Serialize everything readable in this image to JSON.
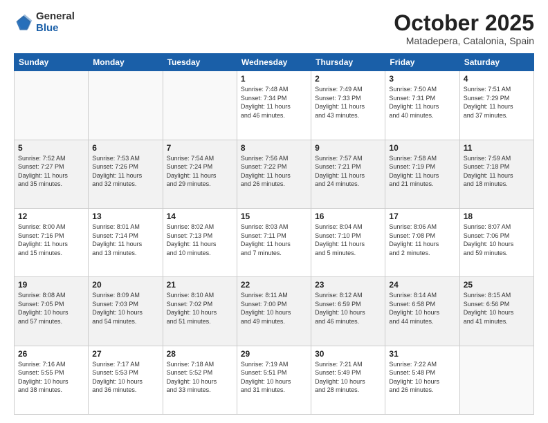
{
  "header": {
    "logo_general": "General",
    "logo_blue": "Blue",
    "month_title": "October 2025",
    "subtitle": "Matadepera, Catalonia, Spain"
  },
  "days_of_week": [
    "Sunday",
    "Monday",
    "Tuesday",
    "Wednesday",
    "Thursday",
    "Friday",
    "Saturday"
  ],
  "weeks": [
    [
      {
        "num": "",
        "info": ""
      },
      {
        "num": "",
        "info": ""
      },
      {
        "num": "",
        "info": ""
      },
      {
        "num": "1",
        "info": "Sunrise: 7:48 AM\nSunset: 7:34 PM\nDaylight: 11 hours\nand 46 minutes."
      },
      {
        "num": "2",
        "info": "Sunrise: 7:49 AM\nSunset: 7:33 PM\nDaylight: 11 hours\nand 43 minutes."
      },
      {
        "num": "3",
        "info": "Sunrise: 7:50 AM\nSunset: 7:31 PM\nDaylight: 11 hours\nand 40 minutes."
      },
      {
        "num": "4",
        "info": "Sunrise: 7:51 AM\nSunset: 7:29 PM\nDaylight: 11 hours\nand 37 minutes."
      }
    ],
    [
      {
        "num": "5",
        "info": "Sunrise: 7:52 AM\nSunset: 7:27 PM\nDaylight: 11 hours\nand 35 minutes."
      },
      {
        "num": "6",
        "info": "Sunrise: 7:53 AM\nSunset: 7:26 PM\nDaylight: 11 hours\nand 32 minutes."
      },
      {
        "num": "7",
        "info": "Sunrise: 7:54 AM\nSunset: 7:24 PM\nDaylight: 11 hours\nand 29 minutes."
      },
      {
        "num": "8",
        "info": "Sunrise: 7:56 AM\nSunset: 7:22 PM\nDaylight: 11 hours\nand 26 minutes."
      },
      {
        "num": "9",
        "info": "Sunrise: 7:57 AM\nSunset: 7:21 PM\nDaylight: 11 hours\nand 24 minutes."
      },
      {
        "num": "10",
        "info": "Sunrise: 7:58 AM\nSunset: 7:19 PM\nDaylight: 11 hours\nand 21 minutes."
      },
      {
        "num": "11",
        "info": "Sunrise: 7:59 AM\nSunset: 7:18 PM\nDaylight: 11 hours\nand 18 minutes."
      }
    ],
    [
      {
        "num": "12",
        "info": "Sunrise: 8:00 AM\nSunset: 7:16 PM\nDaylight: 11 hours\nand 15 minutes."
      },
      {
        "num": "13",
        "info": "Sunrise: 8:01 AM\nSunset: 7:14 PM\nDaylight: 11 hours\nand 13 minutes."
      },
      {
        "num": "14",
        "info": "Sunrise: 8:02 AM\nSunset: 7:13 PM\nDaylight: 11 hours\nand 10 minutes."
      },
      {
        "num": "15",
        "info": "Sunrise: 8:03 AM\nSunset: 7:11 PM\nDaylight: 11 hours\nand 7 minutes."
      },
      {
        "num": "16",
        "info": "Sunrise: 8:04 AM\nSunset: 7:10 PM\nDaylight: 11 hours\nand 5 minutes."
      },
      {
        "num": "17",
        "info": "Sunrise: 8:06 AM\nSunset: 7:08 PM\nDaylight: 11 hours\nand 2 minutes."
      },
      {
        "num": "18",
        "info": "Sunrise: 8:07 AM\nSunset: 7:06 PM\nDaylight: 10 hours\nand 59 minutes."
      }
    ],
    [
      {
        "num": "19",
        "info": "Sunrise: 8:08 AM\nSunset: 7:05 PM\nDaylight: 10 hours\nand 57 minutes."
      },
      {
        "num": "20",
        "info": "Sunrise: 8:09 AM\nSunset: 7:03 PM\nDaylight: 10 hours\nand 54 minutes."
      },
      {
        "num": "21",
        "info": "Sunrise: 8:10 AM\nSunset: 7:02 PM\nDaylight: 10 hours\nand 51 minutes."
      },
      {
        "num": "22",
        "info": "Sunrise: 8:11 AM\nSunset: 7:00 PM\nDaylight: 10 hours\nand 49 minutes."
      },
      {
        "num": "23",
        "info": "Sunrise: 8:12 AM\nSunset: 6:59 PM\nDaylight: 10 hours\nand 46 minutes."
      },
      {
        "num": "24",
        "info": "Sunrise: 8:14 AM\nSunset: 6:58 PM\nDaylight: 10 hours\nand 44 minutes."
      },
      {
        "num": "25",
        "info": "Sunrise: 8:15 AM\nSunset: 6:56 PM\nDaylight: 10 hours\nand 41 minutes."
      }
    ],
    [
      {
        "num": "26",
        "info": "Sunrise: 7:16 AM\nSunset: 5:55 PM\nDaylight: 10 hours\nand 38 minutes."
      },
      {
        "num": "27",
        "info": "Sunrise: 7:17 AM\nSunset: 5:53 PM\nDaylight: 10 hours\nand 36 minutes."
      },
      {
        "num": "28",
        "info": "Sunrise: 7:18 AM\nSunset: 5:52 PM\nDaylight: 10 hours\nand 33 minutes."
      },
      {
        "num": "29",
        "info": "Sunrise: 7:19 AM\nSunset: 5:51 PM\nDaylight: 10 hours\nand 31 minutes."
      },
      {
        "num": "30",
        "info": "Sunrise: 7:21 AM\nSunset: 5:49 PM\nDaylight: 10 hours\nand 28 minutes."
      },
      {
        "num": "31",
        "info": "Sunrise: 7:22 AM\nSunset: 5:48 PM\nDaylight: 10 hours\nand 26 minutes."
      },
      {
        "num": "",
        "info": ""
      }
    ]
  ]
}
